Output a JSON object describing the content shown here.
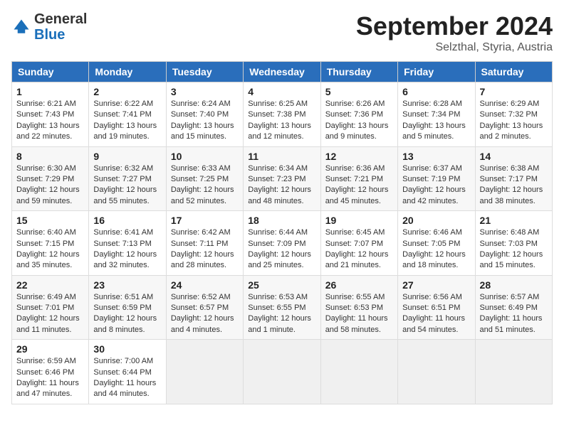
{
  "logo": {
    "general": "General",
    "blue": "Blue"
  },
  "header": {
    "month": "September 2024",
    "location": "Selzthal, Styria, Austria"
  },
  "weekdays": [
    "Sunday",
    "Monday",
    "Tuesday",
    "Wednesday",
    "Thursday",
    "Friday",
    "Saturday"
  ],
  "weeks": [
    [
      {
        "day": "1",
        "info": "Sunrise: 6:21 AM\nSunset: 7:43 PM\nDaylight: 13 hours\nand 22 minutes."
      },
      {
        "day": "2",
        "info": "Sunrise: 6:22 AM\nSunset: 7:41 PM\nDaylight: 13 hours\nand 19 minutes."
      },
      {
        "day": "3",
        "info": "Sunrise: 6:24 AM\nSunset: 7:40 PM\nDaylight: 13 hours\nand 15 minutes."
      },
      {
        "day": "4",
        "info": "Sunrise: 6:25 AM\nSunset: 7:38 PM\nDaylight: 13 hours\nand 12 minutes."
      },
      {
        "day": "5",
        "info": "Sunrise: 6:26 AM\nSunset: 7:36 PM\nDaylight: 13 hours\nand 9 minutes."
      },
      {
        "day": "6",
        "info": "Sunrise: 6:28 AM\nSunset: 7:34 PM\nDaylight: 13 hours\nand 5 minutes."
      },
      {
        "day": "7",
        "info": "Sunrise: 6:29 AM\nSunset: 7:32 PM\nDaylight: 13 hours\nand 2 minutes."
      }
    ],
    [
      {
        "day": "8",
        "info": "Sunrise: 6:30 AM\nSunset: 7:29 PM\nDaylight: 12 hours\nand 59 minutes."
      },
      {
        "day": "9",
        "info": "Sunrise: 6:32 AM\nSunset: 7:27 PM\nDaylight: 12 hours\nand 55 minutes."
      },
      {
        "day": "10",
        "info": "Sunrise: 6:33 AM\nSunset: 7:25 PM\nDaylight: 12 hours\nand 52 minutes."
      },
      {
        "day": "11",
        "info": "Sunrise: 6:34 AM\nSunset: 7:23 PM\nDaylight: 12 hours\nand 48 minutes."
      },
      {
        "day": "12",
        "info": "Sunrise: 6:36 AM\nSunset: 7:21 PM\nDaylight: 12 hours\nand 45 minutes."
      },
      {
        "day": "13",
        "info": "Sunrise: 6:37 AM\nSunset: 7:19 PM\nDaylight: 12 hours\nand 42 minutes."
      },
      {
        "day": "14",
        "info": "Sunrise: 6:38 AM\nSunset: 7:17 PM\nDaylight: 12 hours\nand 38 minutes."
      }
    ],
    [
      {
        "day": "15",
        "info": "Sunrise: 6:40 AM\nSunset: 7:15 PM\nDaylight: 12 hours\nand 35 minutes."
      },
      {
        "day": "16",
        "info": "Sunrise: 6:41 AM\nSunset: 7:13 PM\nDaylight: 12 hours\nand 32 minutes."
      },
      {
        "day": "17",
        "info": "Sunrise: 6:42 AM\nSunset: 7:11 PM\nDaylight: 12 hours\nand 28 minutes."
      },
      {
        "day": "18",
        "info": "Sunrise: 6:44 AM\nSunset: 7:09 PM\nDaylight: 12 hours\nand 25 minutes."
      },
      {
        "day": "19",
        "info": "Sunrise: 6:45 AM\nSunset: 7:07 PM\nDaylight: 12 hours\nand 21 minutes."
      },
      {
        "day": "20",
        "info": "Sunrise: 6:46 AM\nSunset: 7:05 PM\nDaylight: 12 hours\nand 18 minutes."
      },
      {
        "day": "21",
        "info": "Sunrise: 6:48 AM\nSunset: 7:03 PM\nDaylight: 12 hours\nand 15 minutes."
      }
    ],
    [
      {
        "day": "22",
        "info": "Sunrise: 6:49 AM\nSunset: 7:01 PM\nDaylight: 12 hours\nand 11 minutes."
      },
      {
        "day": "23",
        "info": "Sunrise: 6:51 AM\nSunset: 6:59 PM\nDaylight: 12 hours\nand 8 minutes."
      },
      {
        "day": "24",
        "info": "Sunrise: 6:52 AM\nSunset: 6:57 PM\nDaylight: 12 hours\nand 4 minutes."
      },
      {
        "day": "25",
        "info": "Sunrise: 6:53 AM\nSunset: 6:55 PM\nDaylight: 12 hours\nand 1 minute."
      },
      {
        "day": "26",
        "info": "Sunrise: 6:55 AM\nSunset: 6:53 PM\nDaylight: 11 hours\nand 58 minutes."
      },
      {
        "day": "27",
        "info": "Sunrise: 6:56 AM\nSunset: 6:51 PM\nDaylight: 11 hours\nand 54 minutes."
      },
      {
        "day": "28",
        "info": "Sunrise: 6:57 AM\nSunset: 6:49 PM\nDaylight: 11 hours\nand 51 minutes."
      }
    ],
    [
      {
        "day": "29",
        "info": "Sunrise: 6:59 AM\nSunset: 6:46 PM\nDaylight: 11 hours\nand 47 minutes."
      },
      {
        "day": "30",
        "info": "Sunrise: 7:00 AM\nSunset: 6:44 PM\nDaylight: 11 hours\nand 44 minutes."
      },
      {
        "day": "",
        "info": ""
      },
      {
        "day": "",
        "info": ""
      },
      {
        "day": "",
        "info": ""
      },
      {
        "day": "",
        "info": ""
      },
      {
        "day": "",
        "info": ""
      }
    ]
  ]
}
